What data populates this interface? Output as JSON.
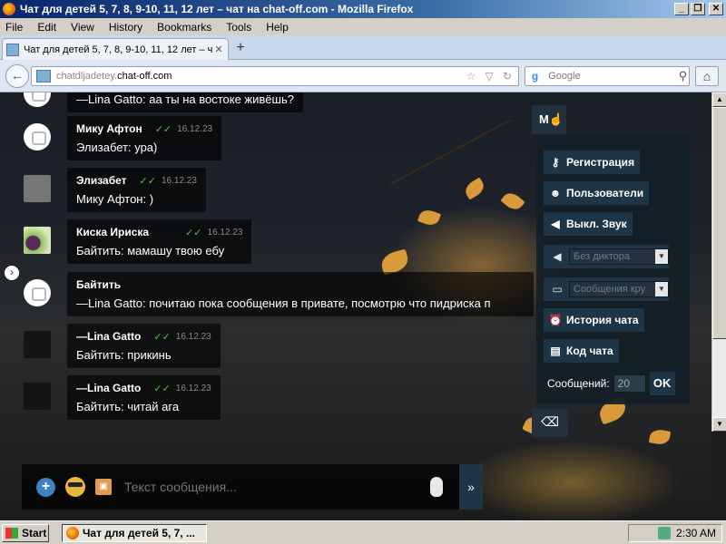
{
  "window": {
    "title": "Чат для детей 5, 7, 8, 9-10, 11, 12 лет – чат на chat-off.com - Mozilla Firefox",
    "minimize": "_",
    "maximize": "❐",
    "close": "✕"
  },
  "menu": [
    "File",
    "Edit",
    "View",
    "History",
    "Bookmarks",
    "Tools",
    "Help"
  ],
  "tab": {
    "title": "Чат для детей 5, 7, 8, 9-10, 11, 12 лет – чат...",
    "close": "✕",
    "new_tab": "+"
  },
  "nav": {
    "back": "←",
    "url_prefix": "chatdljadetey.",
    "url_host": "chat-off.com",
    "search_placeholder": "Google",
    "home": "⌂"
  },
  "messages": [
    {
      "name": "",
      "text": "—Lina Gatto: аа ты на востоке живёшь?",
      "date": "",
      "avatar": "camera"
    },
    {
      "name": "Мику Афтон",
      "text": "Элизабет: ура)",
      "date": "16.12.23",
      "avatar": "camera"
    },
    {
      "name": "Элизабет",
      "text": "Мику Афтон: )",
      "date": "16.12.23",
      "avatar": "photo-gray"
    },
    {
      "name": "Киска Ириска",
      "text": "Байтить: мамашу твою ебу",
      "date": "16.12.23",
      "avatar": "photo-plum"
    },
    {
      "name": "Байтить",
      "text": "—Lina Gatto: почитаю пока сообщения в привате, посмотрю что пидриска п",
      "date": "",
      "avatar": "camera"
    },
    {
      "name": "—Lina Gatto",
      "text": "Байтить: прикинь",
      "date": "16.12.23",
      "avatar": "dark"
    },
    {
      "name": "—Lina Gatto",
      "text": "Байтить: читай ага",
      "date": "16.12.23",
      "avatar": "dark"
    }
  ],
  "check_mark": "✓✓",
  "panel": {
    "toggle_label": "M",
    "register": "Регистрация",
    "users": "Пользователи",
    "sound_off": "Выкл. Звук",
    "narrator_select": "Без диктора",
    "messages_select": "Сообщения кру",
    "history": "История чата",
    "chat_code": "Код чата",
    "messages_label": "Сообщений:",
    "messages_count": "20",
    "ok": "OK"
  },
  "input": {
    "placeholder": "Текст сообщения...",
    "send": "»"
  },
  "side_toggle": "›",
  "taskbar": {
    "start": "Start",
    "task": "Чат для детей 5, 7, ...",
    "clock": "2:30 AM"
  }
}
